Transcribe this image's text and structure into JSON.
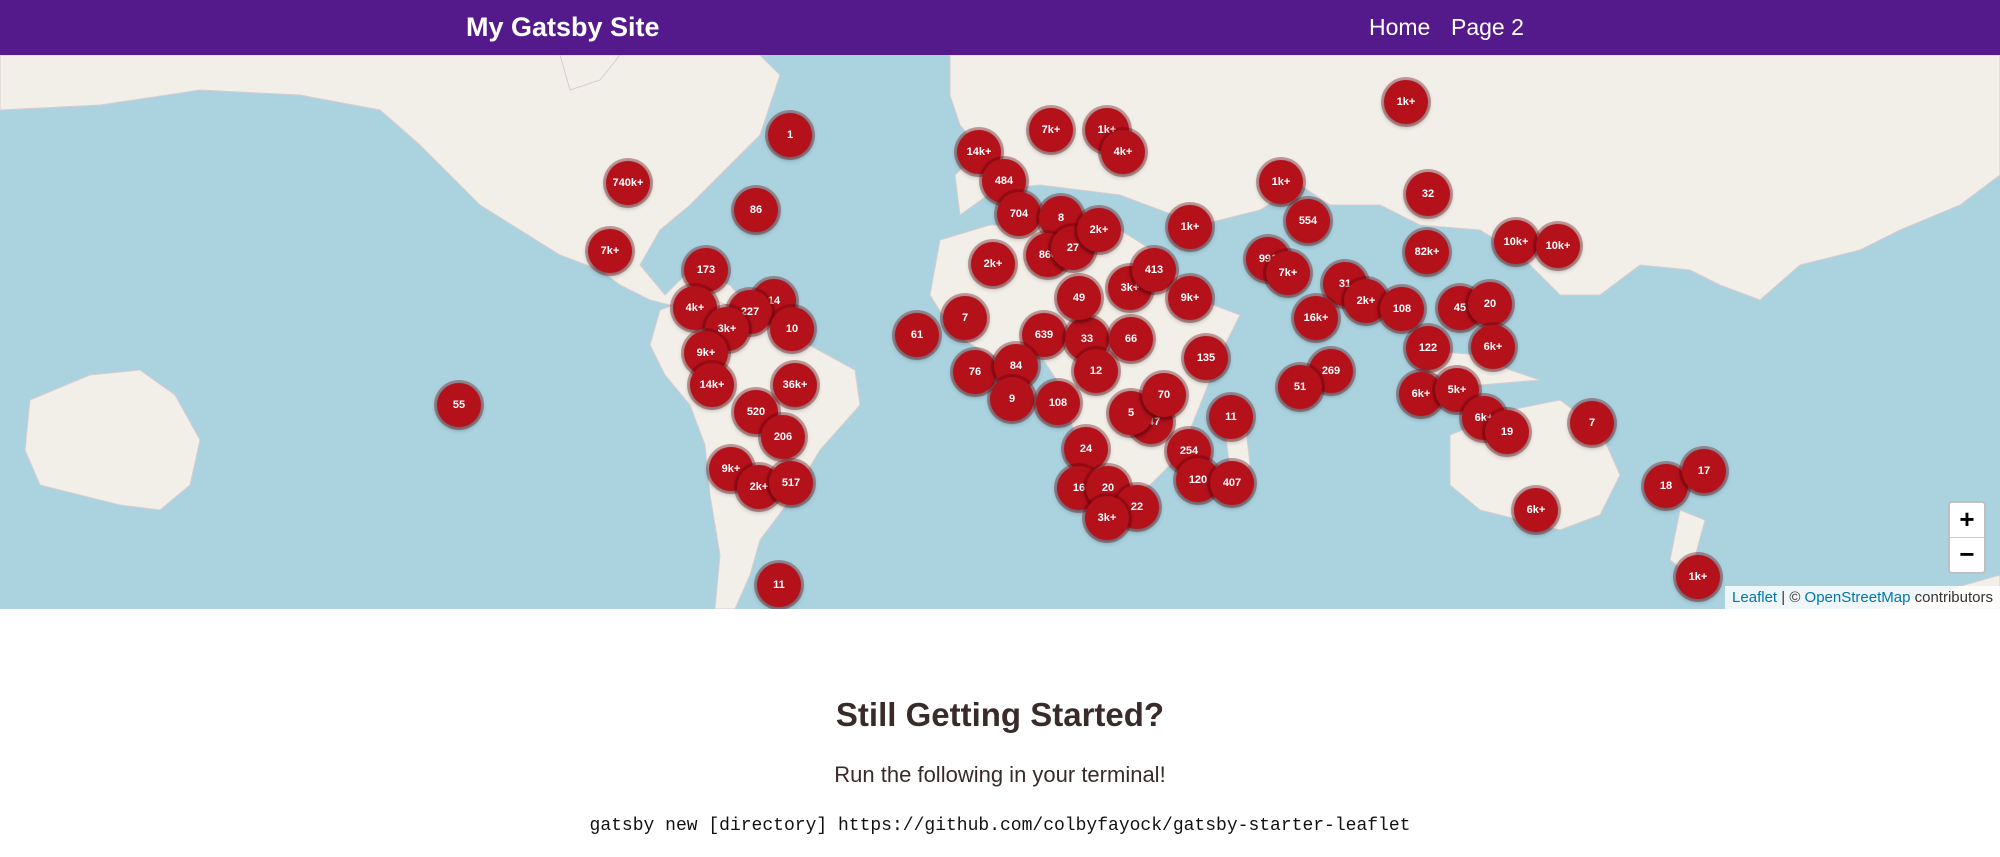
{
  "header": {
    "title": "My Gatsby Site",
    "nav": [
      "Home",
      "Page 2"
    ]
  },
  "map": {
    "clusters": [
      "1",
      "740k+",
      "86",
      "7k+",
      "173",
      "14",
      "227",
      "4k+",
      "3k+",
      "10",
      "9k+",
      "14k+",
      "36k+",
      "55",
      "520",
      "206",
      "9k+",
      "2k+",
      "517",
      "11",
      "14k+",
      "7k+",
      "484",
      "704",
      "8",
      "2k+",
      "866",
      "27",
      "2k+",
      "1k+",
      "4k+",
      "61",
      "7",
      "639",
      "33",
      "66",
      "49",
      "76",
      "84",
      "12",
      "9",
      "108",
      "147",
      "5",
      "70",
      "24",
      "254",
      "16",
      "20",
      "120",
      "407",
      "22",
      "3k+",
      "3k+",
      "413",
      "9k+",
      "1k+",
      "135",
      "11",
      "1k+",
      "554",
      "32",
      "82k+",
      "10k+",
      "10k+",
      "991",
      "7k+",
      "31",
      "2k+",
      "16k+",
      "108",
      "45",
      "20",
      "6k+",
      "122",
      "269",
      "51",
      "6k+",
      "5k+",
      "6k+",
      "19",
      "7",
      "18",
      "17",
      "6k+",
      "1k+",
      "1k+"
    ],
    "zoom_in": "+",
    "zoom_out": "−",
    "attribution": {
      "leaflet": "Leaflet",
      "sep": " | © ",
      "osm": "OpenStreetMap",
      "suffix": " contributors"
    }
  },
  "content": {
    "heading": "Still Getting Started?",
    "subtext": "Run the following in your terminal!",
    "command": "gatsby new [directory] https://github.com/colbyfayock/gatsby-starter-leaflet"
  },
  "colors": {
    "header": "#541a8b",
    "water": "#aad3df",
    "land": "#f2efe9",
    "marker": "#b4111b"
  }
}
